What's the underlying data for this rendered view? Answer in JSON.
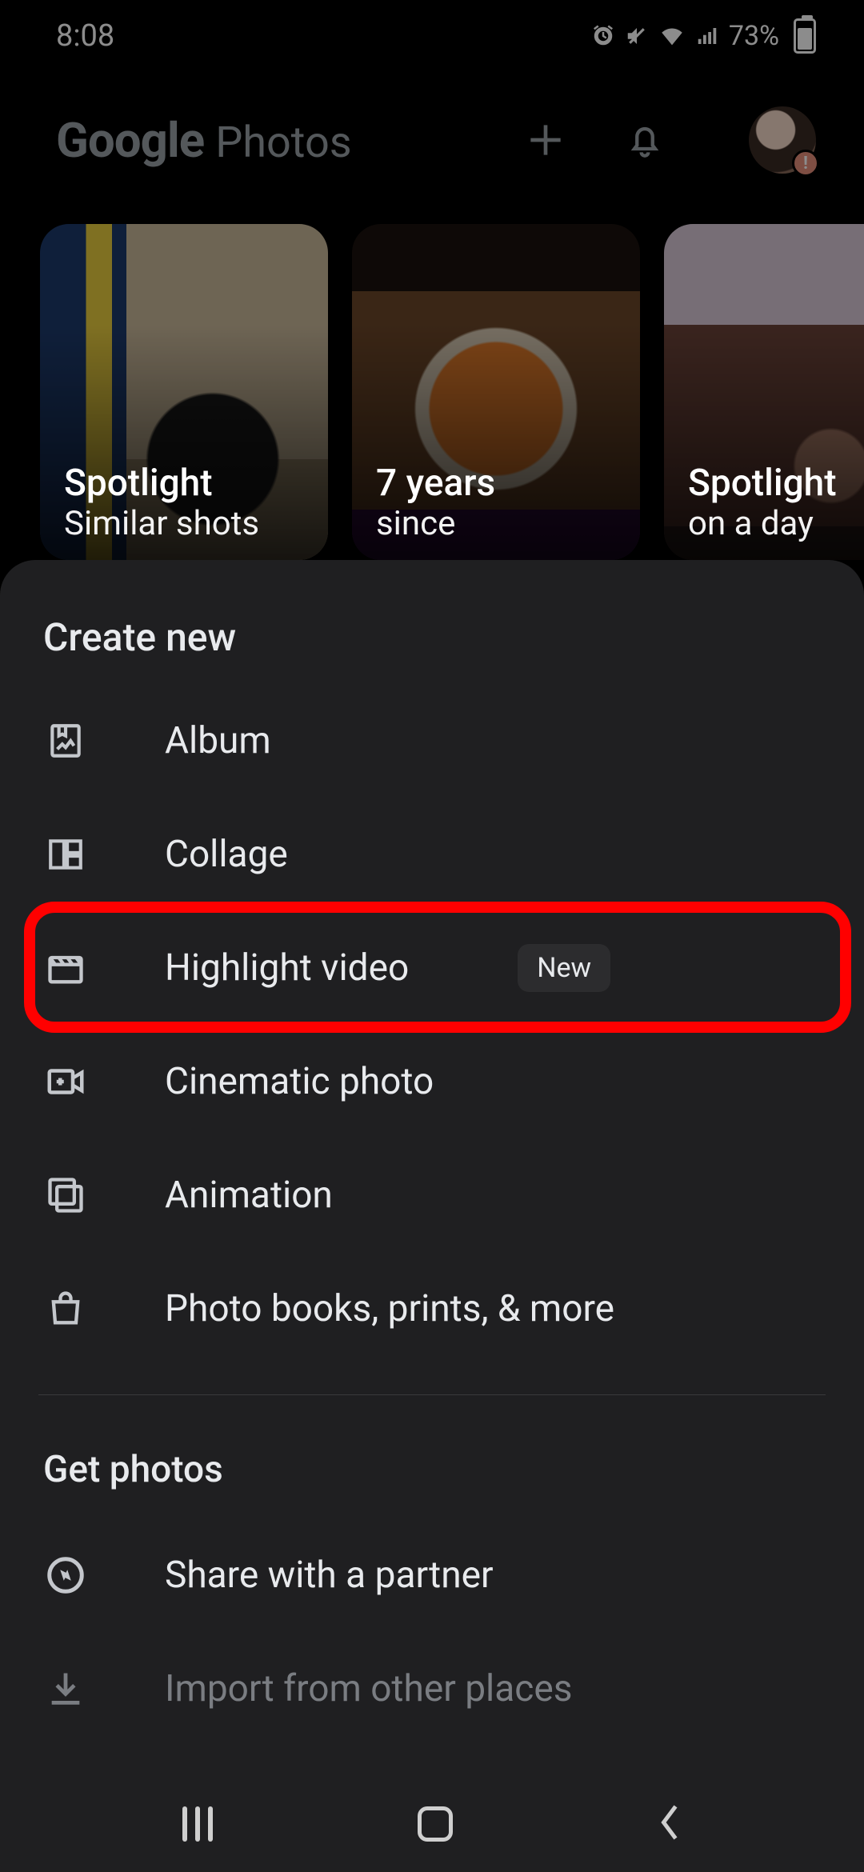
{
  "status": {
    "time": "8:08",
    "battery_pct": "73%"
  },
  "header": {
    "brand": "Google",
    "app": "Photos"
  },
  "memories": [
    {
      "title": "Spotlight",
      "subtitle": "Similar shots"
    },
    {
      "title": "7 years",
      "subtitle": "since"
    },
    {
      "title": "Spotlight",
      "subtitle": "on a day"
    }
  ],
  "sheet": {
    "create_title": "Create new",
    "items": [
      {
        "label": "Album"
      },
      {
        "label": "Collage"
      },
      {
        "label": "Highlight video",
        "badge": "New"
      },
      {
        "label": "Cinematic photo"
      },
      {
        "label": "Animation"
      },
      {
        "label": "Photo books, prints, & more"
      }
    ],
    "get_title": "Get photos",
    "get_items": [
      {
        "label": "Share with a partner"
      },
      {
        "label": "Import from other places"
      }
    ]
  }
}
